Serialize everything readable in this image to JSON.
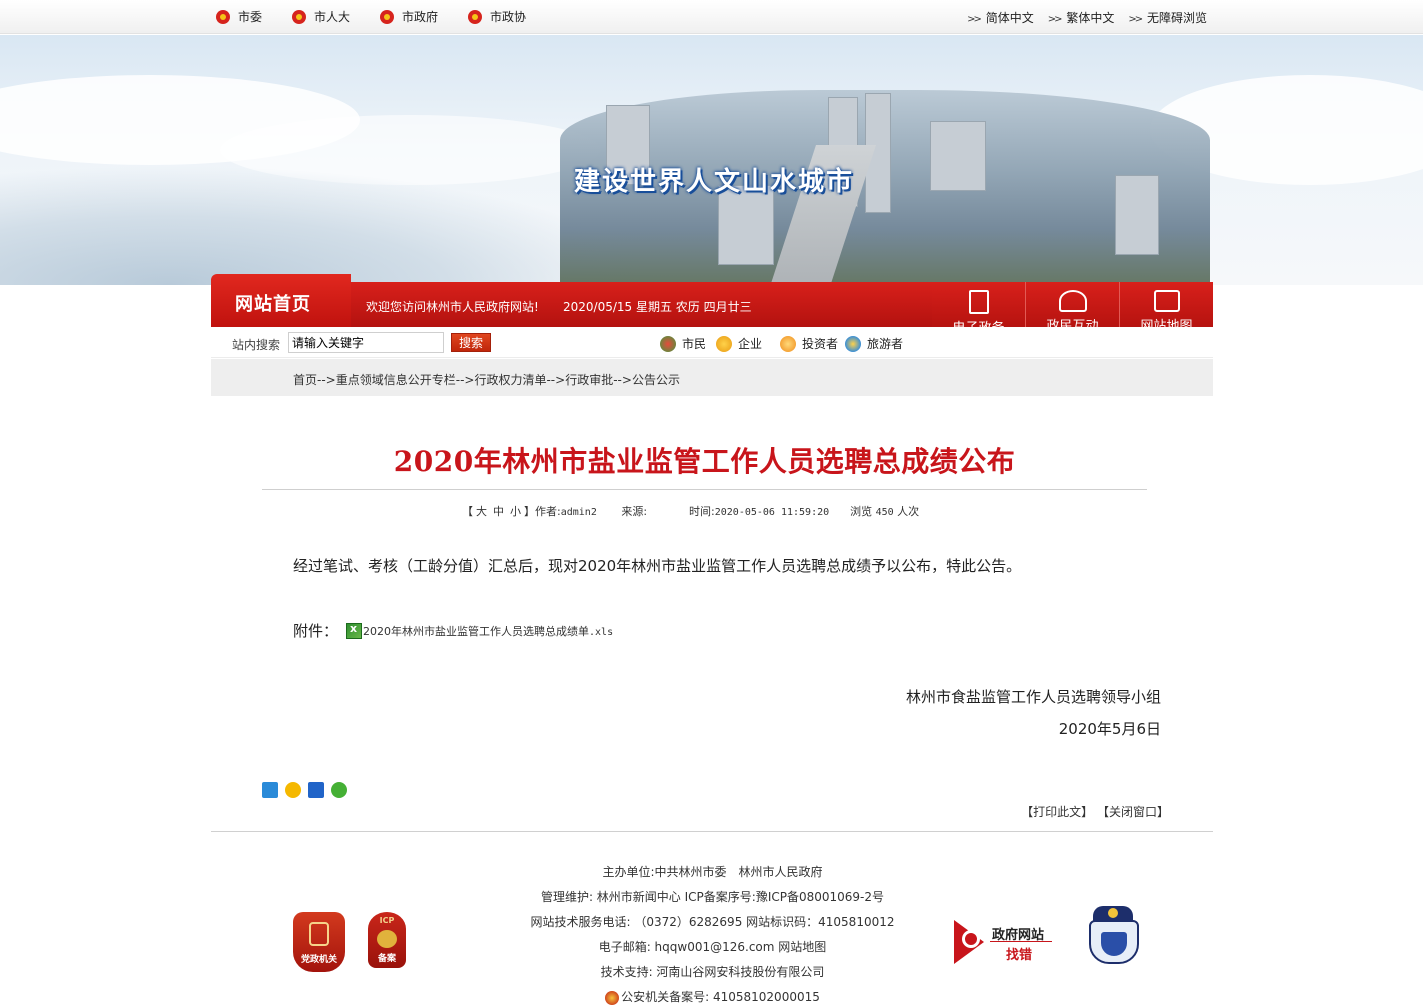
{
  "topbar": {
    "left_links": [
      "市委",
      "市人大",
      "市政府",
      "市政协"
    ],
    "right_links": [
      "简体中文",
      "繁体中文",
      "无障碍浏览"
    ]
  },
  "banner": {
    "slogan": "建设世界人文山水城市"
  },
  "nav": {
    "home": "网站首页",
    "welcome": "欢迎您访问林州市人民政府网站!",
    "date": "2020/05/15 星期五 农历 四月廿三",
    "quick_links": [
      {
        "label": "电子政务",
        "icon": "pen-icon"
      },
      {
        "label": "政民互动",
        "icon": "people-icon"
      },
      {
        "label": "网站地图",
        "icon": "map-icon"
      }
    ]
  },
  "search": {
    "label": "站内搜索",
    "value": "请输入关键字",
    "button": "搜索",
    "audiences": [
      "市民",
      "企业",
      "投资者",
      "旅游者"
    ]
  },
  "breadcrumb": [
    "首页--",
    "重点领域信息公开专栏--",
    "行政权力清单--",
    "行政审批--",
    "公告公示"
  ],
  "article": {
    "title": "2020年林州市盐业监管工作人员选聘总成绩公布",
    "font_label": "【大 中 小】",
    "font_big": "大",
    "font_mid": "中",
    "font_small": "小",
    "author_label": "作者:",
    "author": "admin2",
    "source_label": "来源:",
    "time_label": "时间:",
    "time": "2020-05-06 11:59:20",
    "views_label": "浏览",
    "views": "450",
    "views_unit": "人次",
    "body": "经过笔试、考核（工龄分值）汇总后，现对2020年林州市盐业监管工作人员选聘总成绩予以公布，特此公告。",
    "attachment_label": "附件：",
    "attachment_name": "2020年林州市盐业监管工作人员选聘总成绩单",
    "attachment_ext": ".xls",
    "signature": "林州市食盐监管工作人员选聘领导小组",
    "sign_date": "2020年5月6日"
  },
  "tools": {
    "print": "【打印此文】",
    "close": "【关闭窗口】"
  },
  "footer": {
    "host": "主办单位:中共林州市委　林州市人民政府",
    "maintain": "管理维护: 林州市新闻中心 ICP备案序号:豫ICP备08001069-2号",
    "support_phone": "网站技术服务电话: （0372）6282695 网站标识码：4105810012",
    "email": "电子邮箱: hqqw001@126.com 网站地图",
    "tech": "技术支持: 河南山谷网安科技股份有限公司",
    "police": "公安机关备案号: 41058102000015",
    "badge_party": "党政机关",
    "badge_icp_top": "ICP",
    "badge_icp_bottom": "备案",
    "error_line1": "政府网站",
    "error_line2": "找错"
  },
  "colors": {
    "brand_red": "#c8151b",
    "nav_red": "#d8201b",
    "crumb_bg": "#eeeeee"
  }
}
